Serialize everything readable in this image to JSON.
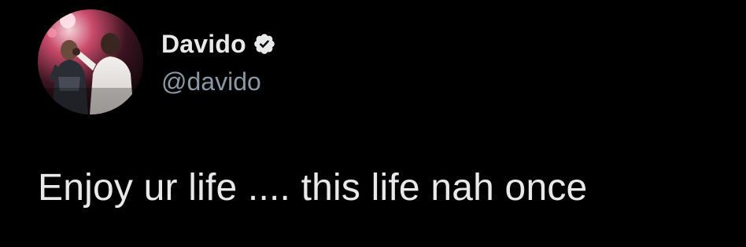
{
  "tweet": {
    "author": {
      "display_name": "Davido",
      "handle": "@davido",
      "verified": true,
      "verified_icon": "verified-badge-icon",
      "avatar": "profile-photo"
    },
    "text": "Enjoy ur life .... this life nah once"
  },
  "colors": {
    "background": "#000000",
    "text_primary": "#e7e9ea",
    "text_secondary": "#8b98a5",
    "badge": "#e7e9ea"
  }
}
